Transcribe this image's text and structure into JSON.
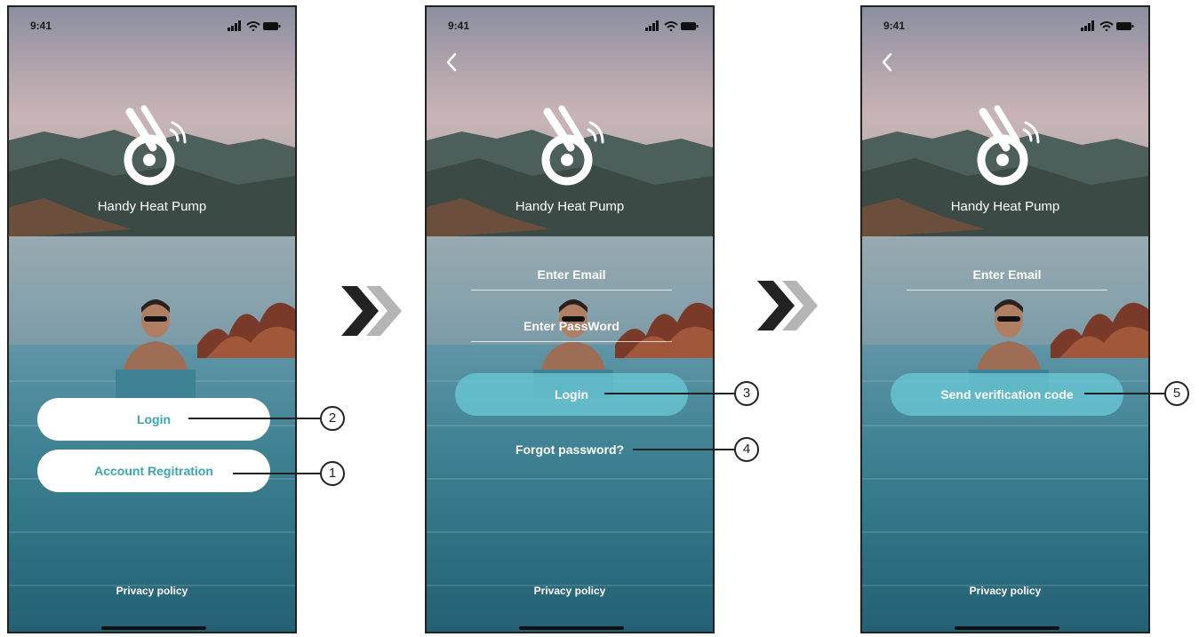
{
  "status_bar": {
    "time": "9:41"
  },
  "app": {
    "name": "Handy Heat Pump"
  },
  "screen_welcome": {
    "login_label": "Login",
    "register_label": "Account Regitration",
    "privacy_label": "Privacy policy"
  },
  "screen_login": {
    "email_placeholder": "Enter Email",
    "password_placeholder": "Enter PassWord",
    "login_label": "Login",
    "forgot_label": "Forgot password?",
    "privacy_label": "Privacy policy"
  },
  "screen_forgot": {
    "email_placeholder": "Enter Email",
    "send_code_label": "Send verification code",
    "privacy_label": "Privacy policy"
  },
  "callouts": {
    "register": "1",
    "welcome_login": "2",
    "login": "3",
    "forgot": "4",
    "send_code": "5"
  },
  "colors": {
    "accent_teal": "#3aa6b4",
    "button_teal": "#69c8d6",
    "arrow_dark": "#222222",
    "arrow_light": "#b5b5b5"
  },
  "icons": [
    "signal-icon",
    "wifi-icon",
    "battery-icon",
    "back-chevron-icon",
    "app-logo-icon",
    "next-arrow-icon"
  ]
}
